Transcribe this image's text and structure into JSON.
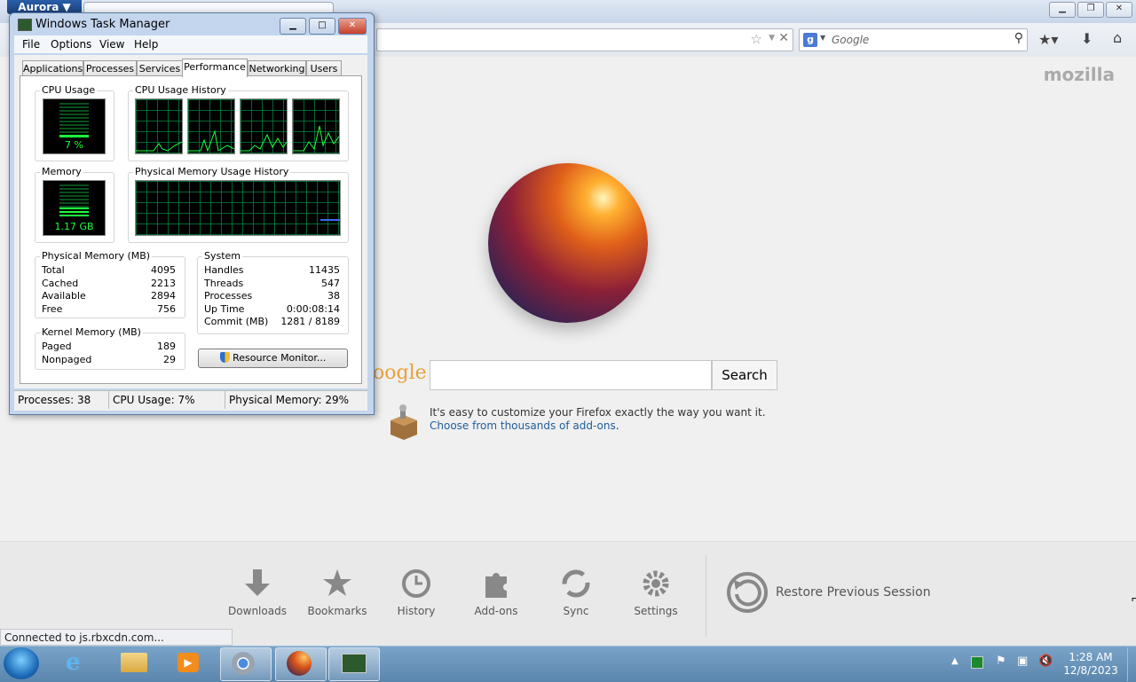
{
  "browser": {
    "app_button_label": "Aurora ▼",
    "search_placeholder": "Google",
    "brand_word": "mozilla",
    "google_logo": "oogle",
    "google_search_button": "Search",
    "addon_text": "It's easy to customize your Firefox exactly the way you want it.",
    "addon_link": "Choose from thousands of add-ons",
    "status": "Connected to js.rbxcdn.com...",
    "launcher": [
      {
        "label": "Downloads",
        "icon": "download-icon"
      },
      {
        "label": "Bookmarks",
        "icon": "star-icon"
      },
      {
        "label": "History",
        "icon": "clock-icon"
      },
      {
        "label": "Add-ons",
        "icon": "puzzle-icon"
      },
      {
        "label": "Sync",
        "icon": "sync-icon"
      },
      {
        "label": "Settings",
        "icon": "gear-icon"
      }
    ],
    "restore_session": "Restore Previous Session"
  },
  "task_manager": {
    "title": "Windows Task Manager",
    "menu": [
      "File",
      "Options",
      "View",
      "Help"
    ],
    "tabs": [
      "Applications",
      "Processes",
      "Services",
      "Performance",
      "Networking",
      "Users"
    ],
    "selected_tab": "Performance",
    "cpu_usage_label": "CPU Usage",
    "cpu_usage_value": "7 %",
    "cpu_history_label": "CPU Usage History",
    "memory_label": "Memory",
    "memory_value": "1.17 GB",
    "memory_history_label": "Physical Memory Usage History",
    "physical_memory": {
      "title": "Physical Memory (MB)",
      "rows": [
        {
          "label": "Total",
          "value": "4095"
        },
        {
          "label": "Cached",
          "value": "2213"
        },
        {
          "label": "Available",
          "value": "2894"
        },
        {
          "label": "Free",
          "value": "756"
        }
      ]
    },
    "system": {
      "title": "System",
      "rows": [
        {
          "label": "Handles",
          "value": "11435"
        },
        {
          "label": "Threads",
          "value": "547"
        },
        {
          "label": "Processes",
          "value": "38"
        },
        {
          "label": "Up Time",
          "value": "0:00:08:14"
        },
        {
          "label": "Commit (MB)",
          "value": "1281 / 8189"
        }
      ]
    },
    "kernel_memory": {
      "title": "Kernel Memory (MB)",
      "rows": [
        {
          "label": "Paged",
          "value": "189"
        },
        {
          "label": "Nonpaged",
          "value": "29"
        }
      ]
    },
    "resource_monitor_button": "Resource Monitor...",
    "status_bar": {
      "processes": "Processes: 38",
      "cpu": "CPU Usage: 7%",
      "memory": "Physical Memory: 29%"
    }
  },
  "taskbar": {
    "time": "1:28 AM",
    "date": "12/8/2023"
  }
}
